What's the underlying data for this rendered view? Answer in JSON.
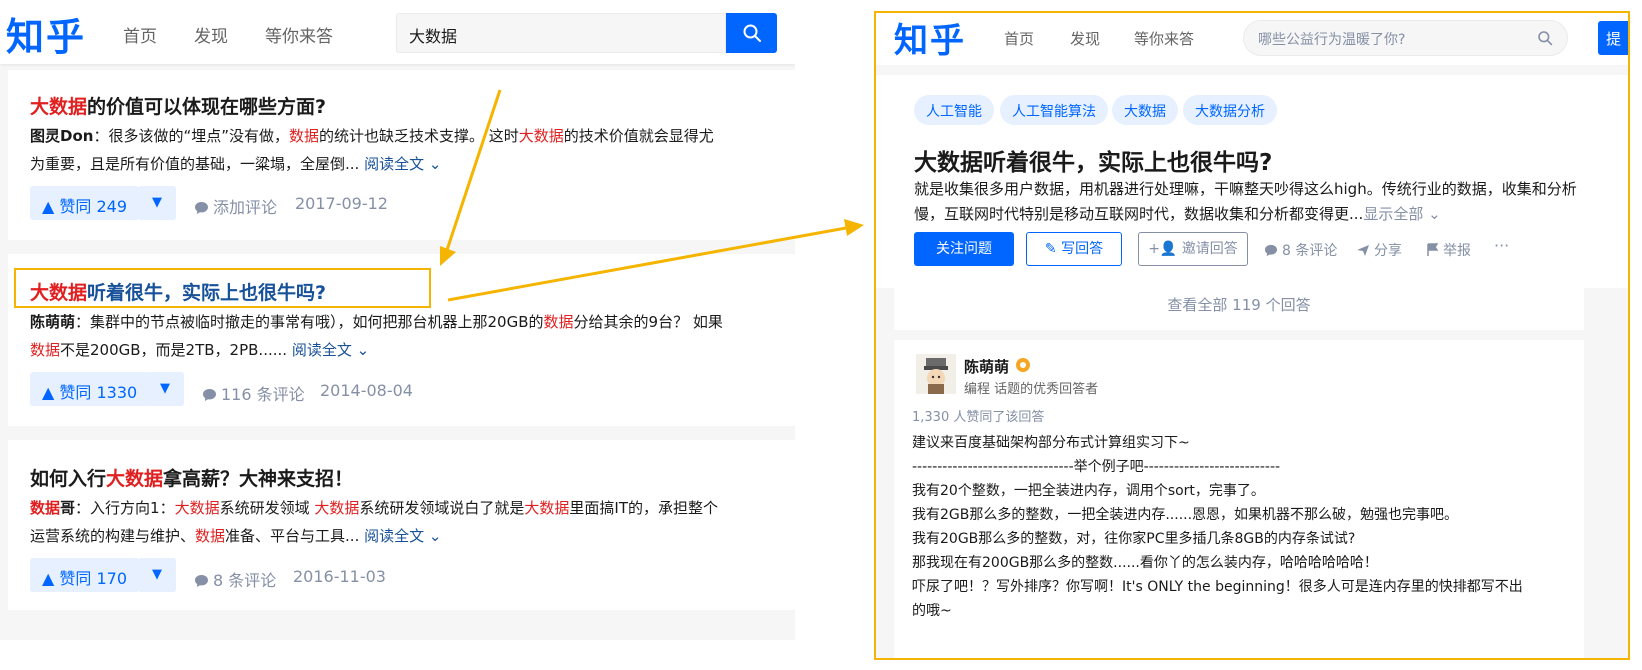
{
  "colors": {
    "brand": "#0066ff",
    "highlight": "#e02020",
    "annotation": "#f5b400"
  },
  "left": {
    "logo": "知乎",
    "nav": [
      "首页",
      "发现",
      "等你来答"
    ],
    "search_value": "大数据",
    "results": [
      {
        "title_hl": "大数据",
        "title_rest": "的价值可以体现在哪些方面?",
        "l1_author": "图灵Don",
        "l1_a": "：很多该做的“埋点”没有做，",
        "l1_hl1": "数据",
        "l1_b": "的统计也缺乏技术支撑。 这时",
        "l1_hl2": "大数据",
        "l1_c": "的技术价值就会显得尤",
        "l2_a": "为重要，且是所有价值的基础，一粱塌，全屋倒...",
        "read_more": "阅读全文",
        "votes": "赞同 249",
        "comments": "添加评论",
        "date": "2017-09-12"
      },
      {
        "title_hl": "大数据",
        "title_rest": "听着很牛，实际上也很牛吗?",
        "l1_author": "陈萌萌",
        "l1_a": "：集群中的节点被临时撤走的事常有哦），如何把那台机器上那20GB的",
        "l1_hl1": "数据",
        "l1_b": "分给其余的9台？ 如果",
        "l2_hl": "数据",
        "l2_a": "不是200GB，而是2TB，2PB......",
        "read_more": "阅读全文",
        "votes": "赞同 1330",
        "comments": "116 条评论",
        "date": "2014-08-04"
      },
      {
        "title_a": "如何入行",
        "title_hl": "大数据",
        "title_rest": "拿高薪？大神来支招！",
        "l1_hl_author": "数据",
        "l1_author": "哥",
        "l1_a": "：入行方向1：",
        "l1_hl1": "大数据",
        "l1_b": "系统研发领域 ",
        "l1_hl2": "大数据",
        "l1_c": "系统研发领域说白了就是",
        "l1_hl3": "大数据",
        "l1_d": "里面搞IT的，承担整个",
        "l2_a": "运营系统的构建与维护、",
        "l2_hl": "数据",
        "l2_b": "准备、平台与工具...",
        "read_more": "阅读全文",
        "votes": "赞同 170",
        "comments": "8 条评论",
        "date": "2016-11-03"
      }
    ]
  },
  "right": {
    "logo": "知乎",
    "nav": [
      "首页",
      "发现",
      "等你来答"
    ],
    "search_placeholder": "哪些公益行为温暖了你?",
    "ask_label": "提",
    "tags": [
      "人工智能",
      "人工智能算法",
      "大数据",
      "大数据分析"
    ],
    "question_title": "大数据听着很牛，实际上也很牛吗?",
    "desc_line1": "就是收集很多用户数据，用机器进行处理嘛，干嘛整天吵得这么high。传统行业的数据，收集和分析",
    "desc_line2": "慢，互联网时代特别是移动互联网时代，数据收集和分析都变得更...",
    "show_all": "显示全部",
    "follow_label": "关注问题",
    "write_label": "写回答",
    "invite_label": "邀请回答",
    "comments_label": "8 条评论",
    "share_label": "分享",
    "report_label": "举报",
    "more_label": "···",
    "view_all": "查看全部 119 个回答",
    "answer": {
      "name": "陈萌萌",
      "bio": "编程 话题的优秀回答者",
      "votes": "1,330 人赞同了该回答",
      "lines": [
        "建议来百度基础架构部分布式计算组实习下~",
        "--------------------------------举个例子吧---------------------------",
        "我有20个整数，一把全装进内存，调用个sort，完事了。",
        "我有2GB那么多的整数，一把全装进内存......恩恩，如果机器不那么破，勉强也完事吧。",
        "我有20GB那么多的整数，对，往你家PC里多插几条8GB的内存条试试?",
        "那我现在有200GB那么多的整数......看你丫的怎么装内存，哈哈哈哈哈哈！",
        "吓尿了吧！？写外排序？你写啊！It's ONLY the beginning！很多人可是连内存里的快排都写不出",
        "的哦~"
      ]
    }
  }
}
